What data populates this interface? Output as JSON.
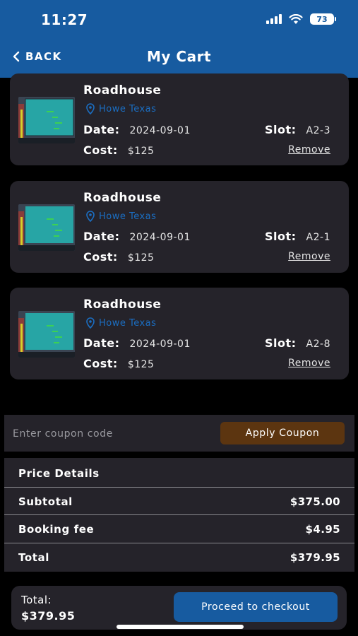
{
  "status_bar": {
    "time": "11:27",
    "battery": "73"
  },
  "header": {
    "back_label": "BACK",
    "title": "My Cart"
  },
  "cart_items": [
    {
      "name": "Roadhouse",
      "location": "Howe Texas",
      "date_label": "Date:",
      "date": "2024-09-01",
      "slot_label": "Slot:",
      "slot": "A2-3",
      "cost_label": "Cost:",
      "cost": "$125",
      "remove_label": "Remove"
    },
    {
      "name": "Roadhouse",
      "location": "Howe Texas",
      "date_label": "Date:",
      "date": "2024-09-01",
      "slot_label": "Slot:",
      "slot": "A2-1",
      "cost_label": "Cost:",
      "cost": "$125",
      "remove_label": "Remove"
    },
    {
      "name": "Roadhouse",
      "location": "Howe Texas",
      "date_label": "Date:",
      "date": "2024-09-01",
      "slot_label": "Slot:",
      "slot": "A2-8",
      "cost_label": "Cost:",
      "cost": "$125",
      "remove_label": "Remove"
    }
  ],
  "coupon": {
    "placeholder": "Enter coupon code",
    "value": "",
    "apply_label": "Apply Coupon"
  },
  "price_details": {
    "heading": "Price Details",
    "subtotal_label": "Subtotal",
    "subtotal": "$375.00",
    "fee_label": "Booking fee",
    "fee": "$4.95",
    "total_label": "Total",
    "total": "$379.95"
  },
  "footer": {
    "total_label": "Total:",
    "total": "$379.95",
    "checkout_label": "Proceed to checkout"
  },
  "colors": {
    "primary": "#175ba0",
    "card_bg": "#25232a",
    "location": "#1b6ec2",
    "apply_button": "#5c3510"
  },
  "icons": {
    "back": "chevron-left-icon",
    "location": "map-pin-icon"
  }
}
